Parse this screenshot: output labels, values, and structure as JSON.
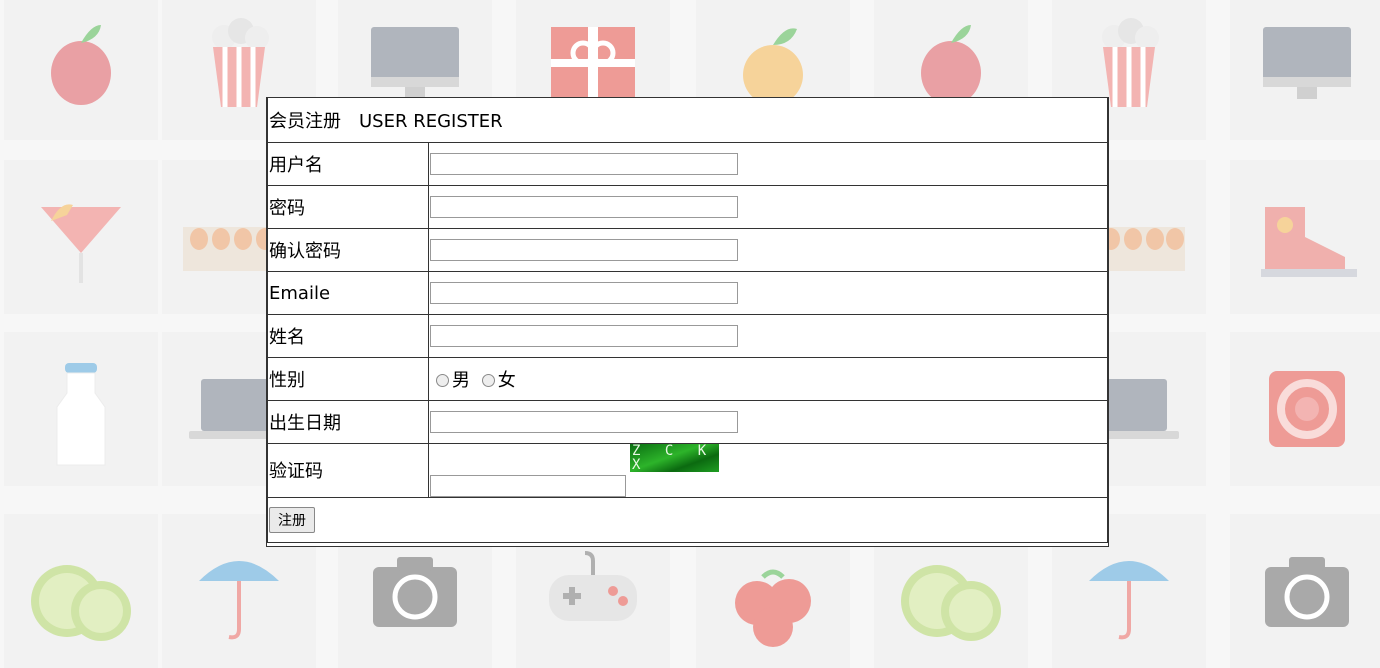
{
  "background": {
    "columns": 8,
    "rows": 4,
    "icons": [
      [
        "apple-icon",
        "popcorn-icon",
        "monitor-icon",
        "gift-icon",
        "orange-icon",
        "apple-icon",
        "popcorn-icon",
        "monitor-icon"
      ],
      [
        "cocktail-icon",
        "eggs-icon",
        "eggs-icon",
        "eggs-icon",
        "eggs-icon",
        "eggs-icon",
        "eggs-icon",
        "sneaker-icon"
      ],
      [
        "milk-bottle-icon",
        "laptop-icon",
        "laptop-icon",
        "laptop-icon",
        "laptop-icon",
        "laptop-icon",
        "laptop-icon",
        "ipod-icon"
      ],
      [
        "kiwi-icon",
        "umbrella-icon",
        "camera-icon",
        "gamepad-icon",
        "tomato-icon",
        "kiwi-icon",
        "umbrella-icon",
        "camera-icon"
      ]
    ]
  },
  "form": {
    "title_cn": "会员注册",
    "title_en": "USER REGISTER",
    "fields": {
      "username": {
        "label": "用户名",
        "value": ""
      },
      "password": {
        "label": "密码",
        "value": ""
      },
      "confirm_password": {
        "label": "确认密码",
        "value": ""
      },
      "email": {
        "label": "Emaile",
        "value": ""
      },
      "name": {
        "label": "姓名",
        "value": ""
      },
      "gender": {
        "label": "性别",
        "options": [
          "男",
          "女"
        ]
      },
      "birthdate": {
        "label": "出生日期",
        "value": ""
      },
      "captcha": {
        "label": "验证码",
        "value": "",
        "image_text": "Z C K X"
      }
    },
    "submit_label": "注册"
  },
  "colors": {
    "border": "#333333",
    "captcha_green": "#1f9e22"
  }
}
